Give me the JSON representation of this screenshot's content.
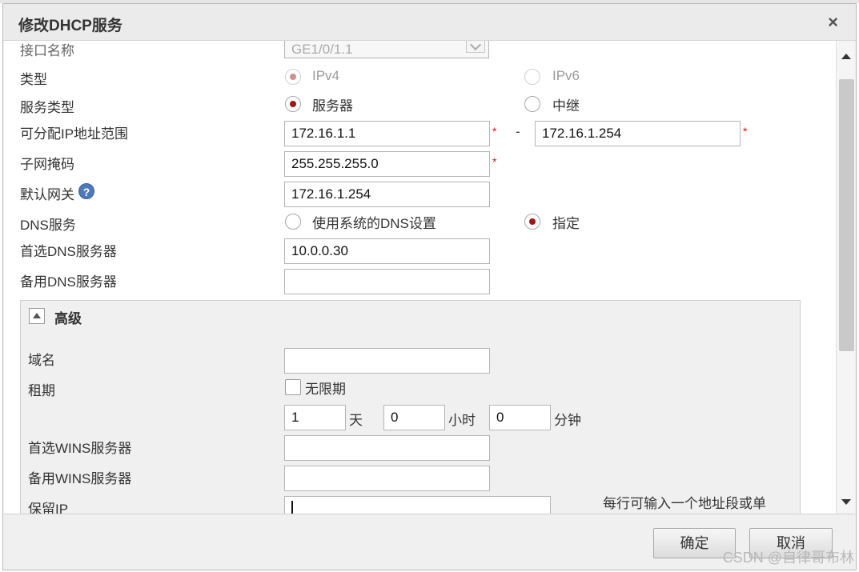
{
  "dialog": {
    "title": "修改DHCP服务",
    "close_glyph": "×"
  },
  "form": {
    "interface": {
      "label": "接口名称",
      "value": "GE1/0/1.1"
    },
    "type": {
      "label": "类型",
      "options": [
        "IPv4",
        "IPv6"
      ],
      "selected": "IPv4"
    },
    "service_type": {
      "label": "服务类型",
      "options": [
        "服务器",
        "中继"
      ],
      "selected": "服务器"
    },
    "ip_range": {
      "label": "可分配IP地址范围",
      "start": "172.16.1.1",
      "separator": "-",
      "end": "172.16.1.254",
      "required_mark": "*"
    },
    "subnet_mask": {
      "label": "子网掩码",
      "value": "255.255.255.0",
      "required_mark": "*"
    },
    "gateway": {
      "label": "默认网关",
      "value": "172.16.1.254",
      "help_glyph": "?"
    },
    "dns_service": {
      "label": "DNS服务",
      "options": [
        "使用系统的DNS设置",
        "指定"
      ],
      "selected": "指定"
    },
    "primary_dns": {
      "label": "首选DNS服务器",
      "value": "10.0.0.30"
    },
    "secondary_dns": {
      "label": "备用DNS服务器",
      "value": ""
    }
  },
  "advanced": {
    "title": "高级",
    "domain": {
      "label": "域名",
      "value": ""
    },
    "lease": {
      "label": "租期",
      "unlimited_label": "无限期",
      "unlimited_checked": false,
      "days": "1",
      "days_unit": "天",
      "hours": "0",
      "hours_unit": "小时",
      "minutes": "0",
      "minutes_unit": "分钟"
    },
    "primary_wins": {
      "label": "首选WINS服务器",
      "value": ""
    },
    "secondary_wins": {
      "label": "备用WINS服务器",
      "value": ""
    },
    "reserved_ip": {
      "label": "保留IP",
      "value": "",
      "hint": "每行可输入一个地址段或单"
    }
  },
  "footer": {
    "ok_label": "确定",
    "cancel_label": "取消"
  },
  "watermark": "CSDN @自律哥布林",
  "colors": {
    "radio_selected": "#a31515",
    "required": "#e01010",
    "help_icon": "#4e79b8"
  }
}
